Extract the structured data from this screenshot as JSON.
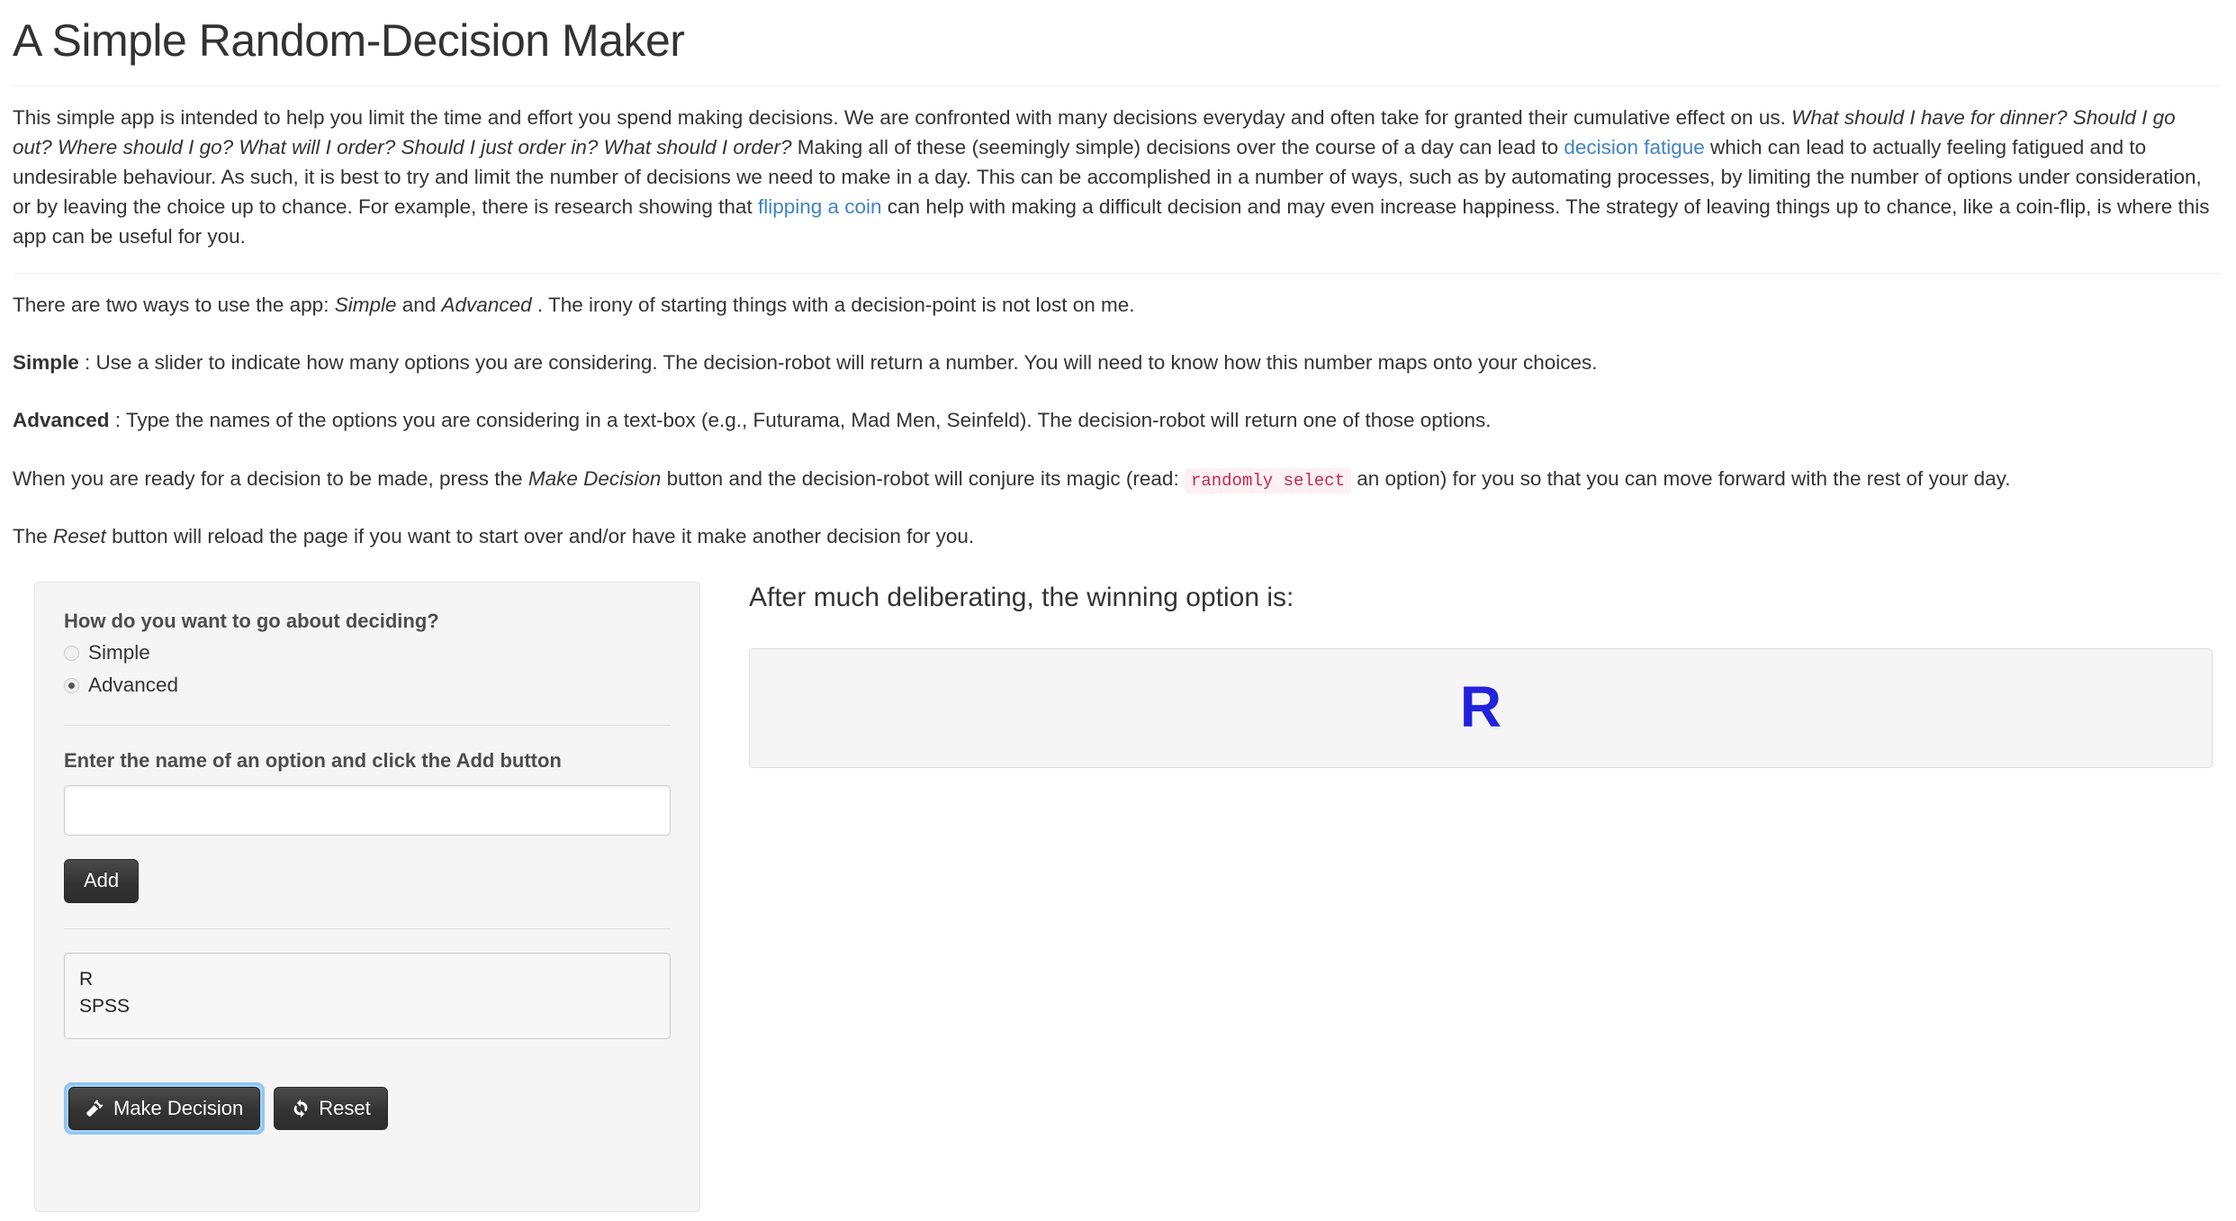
{
  "page": {
    "title": "A Simple Random-Decision Maker"
  },
  "intro": {
    "p1_a": "This simple app is intended to help you limit the time and effort you spend making decisions. We are confronted with many decisions everyday and often take for granted their cumulative effect on us. ",
    "p1_em1": "What should I have for dinner? Should I go out? Where should I go? What will I order? Should I just order in? What should I order?",
    "p1_b": " Making all of these (seemingly simple) decisions over the course of a day can lead to ",
    "p1_link1": "decision fatigue",
    "p1_c": " which can lead to actually feeling fatigued and to undesirable behaviour. As such, it is best to try and limit the number of decisions we need to make in a day. This can be accomplished in a number of ways, such as by automating processes, by limiting the number of options under consideration, or by leaving the choice up to chance. For example, there is research showing that ",
    "p1_link2": "flipping a coin",
    "p1_d": " can help with making a difficult decision and may even increase happiness. The strategy of leaving things up to chance, like a coin-flip, is where this app can be useful for you."
  },
  "usage": {
    "ways_a": "There are two ways to use the app: ",
    "ways_em1": "Simple",
    "ways_b": " and ",
    "ways_em2": "Advanced",
    "ways_c": " . The irony of starting things with a decision-point is not lost on me.",
    "simple_label": "Simple",
    "simple_text": " : Use a slider to indicate how many options you are considering. The decision-robot will return a number. You will need to know how this number maps onto your choices.",
    "advanced_label": "Advanced",
    "advanced_text": " : Type the names of the options you are considering in a text-box (e.g., Futurama, Mad Men, Seinfeld). The decision-robot will return one of those options.",
    "make_a": "When you are ready for a decision to be made, press the ",
    "make_em": "Make Decision",
    "make_b": " button and the decision-robot will conjure its magic (read: ",
    "make_code": "randomly select",
    "make_c": " an option) for you so that you can move forward with the rest of your day.",
    "reset_a": "The ",
    "reset_em": "Reset",
    "reset_b": " button will reload the page if you want to start over and/or have it make another decision for you."
  },
  "sidebar": {
    "mode_question": "How do you want to go about deciding?",
    "modes": [
      {
        "label": "Simple",
        "selected": false
      },
      {
        "label": "Advanced",
        "selected": true
      }
    ],
    "option_input_label": "Enter the name of an option and click the Add button",
    "option_input_value": "",
    "option_input_placeholder": "",
    "add_label": "Add",
    "options": [
      "R",
      "SPSS"
    ],
    "options_text": "R\nSPSS",
    "make_decision_label": "Make Decision",
    "reset_label": "Reset"
  },
  "result": {
    "heading": "After much deliberating, the winning option is:",
    "value": "R",
    "value_color": "#2222dd"
  }
}
